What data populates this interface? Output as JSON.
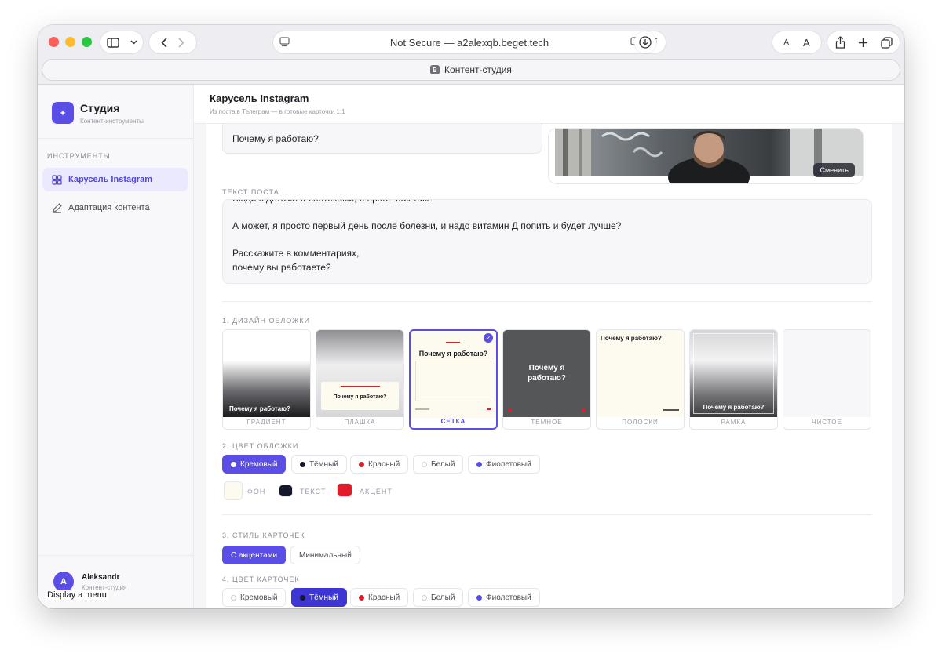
{
  "browser": {
    "url_text": "Not Secure — a2alexqb.beget.tech",
    "tab_title": "Контент-студия",
    "tab_favicon_letter": "B",
    "font_small": "A",
    "font_large": "A"
  },
  "sidebar": {
    "brand": "Студия",
    "brand_sub": "Контент-инструменты",
    "logo_glyph": "✦",
    "section_title": "ИНСТРУМЕНТЫ",
    "items": [
      {
        "label": "Карусель Instagram",
        "icon": "grid-icon",
        "active": true
      },
      {
        "label": "Адаптация контента",
        "icon": "pen-icon",
        "active": false
      }
    ],
    "user": {
      "initial": "A",
      "name": "Aleksandr",
      "role": "Контент-студия"
    },
    "tooltip": "Display a menu"
  },
  "header": {
    "title": "Карусель Instagram",
    "subtitle": "Из поста в Телеграм — в готовые карточки 1:1"
  },
  "form": {
    "headline_value": "Почему я работаю?",
    "photo_button": "Сменить",
    "post_label": "ТЕКСТ ПОСТА",
    "post_lines": [
      "Люди с детьми и ипотеками, я прав? Как там?",
      "",
      "А может, я просто первый день после болезни, и надо витамин Д попить и будет лучше?",
      "",
      "Расскажите в комментариях,",
      "почему вы работаете?"
    ]
  },
  "cover_design": {
    "label": "1. ДИЗАЙН ОБЛОЖКИ",
    "preview_text": "Почему я работаю?",
    "options": [
      {
        "name": "ГРАДИЕНТ"
      },
      {
        "name": "ПЛАШКА"
      },
      {
        "name": "СЕТКА",
        "selected": true
      },
      {
        "name": "ТЁМНОЕ"
      },
      {
        "name": "ПОЛОСКИ"
      },
      {
        "name": "РАМКА"
      },
      {
        "name": "ЧИСТОЕ"
      }
    ]
  },
  "cover_color": {
    "label": "2. ЦВЕТ ОБЛОЖКИ",
    "options": [
      {
        "label": "Кремовый",
        "dot": "#ffffff",
        "active": true
      },
      {
        "label": "Тёмный",
        "dot": "#14172c"
      },
      {
        "label": "Красный",
        "dot": "#e11d2a"
      },
      {
        "label": "Белый",
        "dot": "#ffffff"
      },
      {
        "label": "Фиолетовый",
        "dot": "#5b4ee6"
      }
    ],
    "swatches": [
      {
        "label": "ФОН",
        "color": "#fdfaf0"
      },
      {
        "label": "ТЕКСТ",
        "color": "#14172c"
      },
      {
        "label": "АКЦЕНТ",
        "color": "#e11d2a"
      }
    ]
  },
  "card_style": {
    "label": "3. СТИЛЬ КАРТОЧЕК",
    "options": [
      {
        "label": "С акцентами",
        "active": true
      },
      {
        "label": "Минимальный"
      }
    ]
  },
  "card_color": {
    "label": "4. ЦВЕТ КАРТОЧЕК",
    "options": [
      {
        "label": "Кремовый",
        "dot": "#ffffff"
      },
      {
        "label": "Тёмный",
        "dot": "#14172c",
        "active": true
      },
      {
        "label": "Красный",
        "dot": "#e11d2a"
      },
      {
        "label": "Белый",
        "dot": "#ffffff"
      },
      {
        "label": "Фиолетовый",
        "dot": "#5b4ee6"
      }
    ]
  },
  "colors": {
    "accent": "#5b4ee6",
    "sidebar_active_bg": "#ebe9fd"
  }
}
